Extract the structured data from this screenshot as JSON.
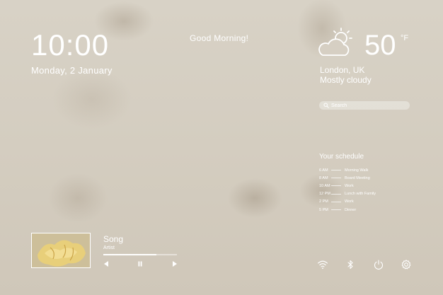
{
  "clock": {
    "time": "10:00",
    "date": "Monday, 2 January"
  },
  "greeting": "Good Morning!",
  "weather": {
    "icon": "partly-cloudy-icon",
    "temperature": "50",
    "unit": "°F",
    "location": "London, UK",
    "condition": "Mostly cloudy"
  },
  "search": {
    "placeholder": "Search",
    "icon": "search-icon"
  },
  "schedule": {
    "title": "Your schedule",
    "items": [
      {
        "time": "6 AM",
        "event": "Morning Walk"
      },
      {
        "time": "8 AM",
        "event": "Board Meeting"
      },
      {
        "time": "10 AM",
        "event": "Work"
      },
      {
        "time": "12 PM",
        "event": "Lunch with Family"
      },
      {
        "time": "2 PM",
        "event": "Work"
      },
      {
        "time": "5 PM",
        "event": "Dinner"
      }
    ]
  },
  "player": {
    "song": "Song",
    "artist": "Artist",
    "progress": 0.72,
    "controls": [
      "previous-icon",
      "pause-icon",
      "next-icon"
    ]
  },
  "system_icons": [
    "wifi-icon",
    "bluetooth-icon",
    "power-icon",
    "settings-icon"
  ],
  "colors": {
    "text": "#ffffff",
    "background": "#d6cfc3"
  }
}
